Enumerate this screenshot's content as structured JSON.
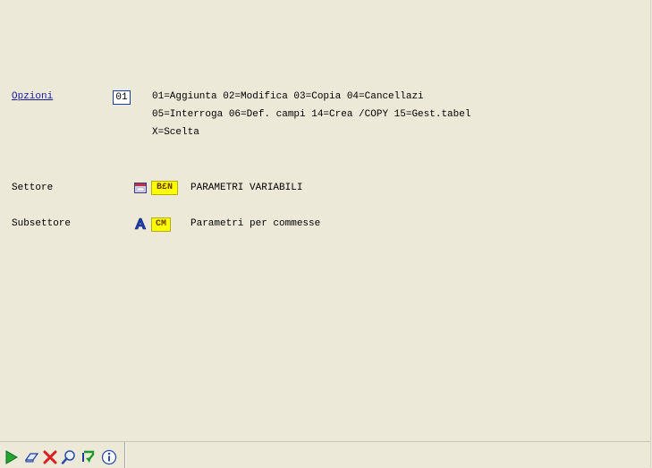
{
  "options": {
    "label": "Opzioni",
    "value": "01",
    "lines": [
      "01=Aggiunta 02=Modifica 03=Copia 04=Cancellazi",
      "05=Interroga 06=Def. campi 14=Crea /COPY 15=Gest.tabel",
      "X=Scelta"
    ]
  },
  "settore": {
    "label": "Settore",
    "code": "B£N",
    "description": "PARAMETRI VARIABILI",
    "icon": "window-icon"
  },
  "subsettore": {
    "label": "Subsettore",
    "code": "CM",
    "description": "Parametri per commesse",
    "icon": "font-a-icon"
  },
  "toolbar": {
    "buttons": [
      "run-icon",
      "eraser-icon",
      "delete-icon",
      "search-icon",
      "refresh-icon",
      "info-icon"
    ]
  },
  "colors": {
    "background": "#ece9d8",
    "link": "#1a1a9c",
    "code_bg": "#ffff00",
    "input_border": "#1c3fa8"
  }
}
